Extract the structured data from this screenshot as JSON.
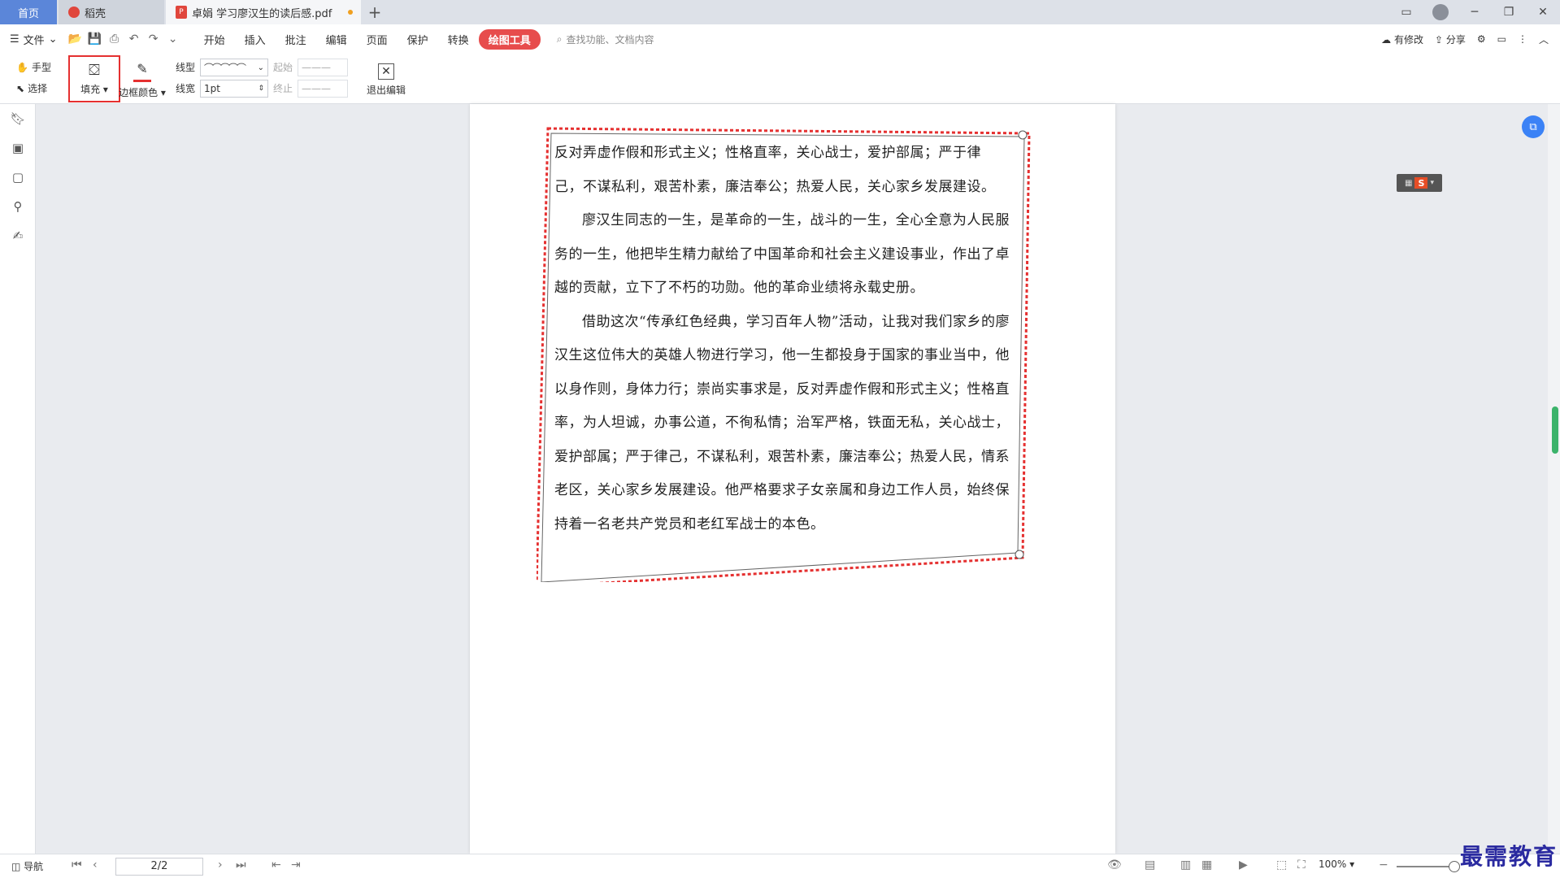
{
  "tabs": {
    "home": "首页",
    "daoke": "稻壳",
    "document": "卓娟 学习廖汉生的读后感.pdf",
    "add": "+"
  },
  "menu": {
    "file": "文件",
    "items": [
      "开始",
      "插入",
      "批注",
      "编辑",
      "页面",
      "保护",
      "转换"
    ],
    "active": "绘图工具",
    "search_placeholder": "查找功能、文档内容",
    "has_changes": "有修改",
    "share": "分享"
  },
  "ribbon": {
    "hand": "手型",
    "select": "选择",
    "fill": "填充",
    "border_color": "边框颜色",
    "line_type_label": "线型",
    "line_width_label": "线宽",
    "line_width_value": "1pt",
    "start_label": "起始",
    "end_label": "终止",
    "exit_edit": "退出编辑"
  },
  "document_text": {
    "p1_line1": "反对弄虚作假和形式主义；性格直率，关心战士，爱护部属；严于律",
    "p1_line2": "己，不谋私利，艰苦朴素，廉洁奉公；热爱人民，关心家乡发展建设。",
    "p2": "廖汉生同志的一生，是革命的一生，战斗的一生，全心全意为人民服务的一生，他把毕生精力献给了中国革命和社会主义建设事业，作出了卓越的贡献，立下了不朽的功勋。他的革命业绩将永载史册。",
    "p3": "借助这次“传承红色经典，学习百年人物”活动，让我对我们家乡的廖汉生这位伟大的英雄人物进行学习，他一生都投身于国家的事业当中，他以身作则，身体力行；崇尚实事求是，反对弄虚作假和形式主义；性格直率，为人坦诚，办事公道，不徇私情；治军严格，铁面无私，关心战士，爱护部属；严于律己，不谋私利，艰苦朴素，廉洁奉公；热爱人民，情系老区，关心家乡发展建设。他严格要求子女亲属和身边工作人员，始终保持着一名老共产党员和老红军战士的本色。"
  },
  "status": {
    "nav": "导航",
    "page": "2/2",
    "zoom": "100%"
  },
  "watermark": "最需教育",
  "colors": {
    "accent": "#e74c4c",
    "home_tab": "#5b86d9",
    "border_stroke": "#e53030"
  }
}
